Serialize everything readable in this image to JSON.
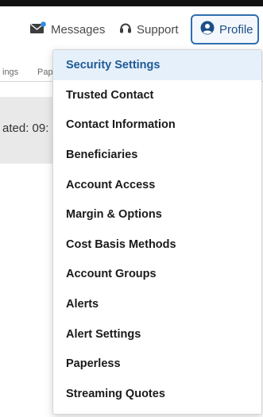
{
  "header": {
    "messages_label": "Messages",
    "support_label": "Support",
    "profile_label": "Profile",
    "messages_icon": "envelope-icon",
    "support_icon": "headset-icon",
    "profile_icon": "user-circle-icon",
    "accent_color": "#2f6fb0",
    "notification_dot_color": "#2f8ee0"
  },
  "background": {
    "tab_1": "ings",
    "tab_2": "Pap",
    "updated_text": "ated: 09:"
  },
  "profile_menu": {
    "items": [
      {
        "label": "Security Settings",
        "active": true
      },
      {
        "label": "Trusted Contact"
      },
      {
        "label": "Contact Information"
      },
      {
        "label": "Beneficiaries"
      },
      {
        "label": "Account Access"
      },
      {
        "label": "Margin & Options"
      },
      {
        "label": "Cost Basis Methods"
      },
      {
        "label": "Account Groups"
      },
      {
        "label": "Alerts"
      },
      {
        "label": "Alert Settings"
      },
      {
        "label": "Paperless"
      },
      {
        "label": "Streaming Quotes"
      }
    ]
  }
}
